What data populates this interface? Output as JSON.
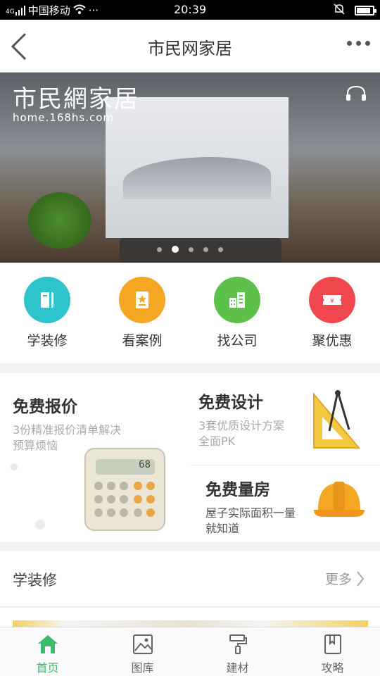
{
  "status_bar": {
    "network": "4G",
    "carrier": "中国移动",
    "extra": "···",
    "time": "20:39",
    "battery_level": 0.85
  },
  "header": {
    "title": "市民网家居"
  },
  "banner": {
    "logo_text": "市民網家居",
    "logo_url": "home.168hs.com",
    "slide_count": 5,
    "active_slide": 2
  },
  "quick_nav": [
    {
      "label": "学装修",
      "icon": "book-icon",
      "color": "#2ec4cc"
    },
    {
      "label": "看案例",
      "icon": "star-document-icon",
      "color": "#f5a623"
    },
    {
      "label": "找公司",
      "icon": "buildings-icon",
      "color": "#5cc04a"
    },
    {
      "label": "聚优惠",
      "icon": "yen-ticket-icon",
      "color": "#f0464e"
    }
  ],
  "promo": {
    "quote": {
      "title": "免费报价",
      "subtitle_line1": "3份精准报价清单解决",
      "subtitle_line2": "预算烦恼",
      "display": "68"
    },
    "design": {
      "title": "免费设计",
      "subtitle_line1": "3套优质设计方案",
      "subtitle_line2": "全面PK"
    },
    "measure": {
      "title": "免费量房",
      "subtitle_line1": "屋子实际面积一量",
      "subtitle_line2": "就知道"
    }
  },
  "learn_section": {
    "title": "学装修",
    "more_label": "更多"
  },
  "tab_bar": [
    {
      "label": "首页",
      "icon": "home-icon",
      "active": true
    },
    {
      "label": "图库",
      "icon": "image-icon",
      "active": false
    },
    {
      "label": "建材",
      "icon": "paint-roller-icon",
      "active": false
    },
    {
      "label": "攻略",
      "icon": "guide-book-icon",
      "active": false
    }
  ],
  "colors": {
    "accent_green": "#3cb96b",
    "text_dark": "#333333",
    "text_muted": "#aaaaaa"
  }
}
